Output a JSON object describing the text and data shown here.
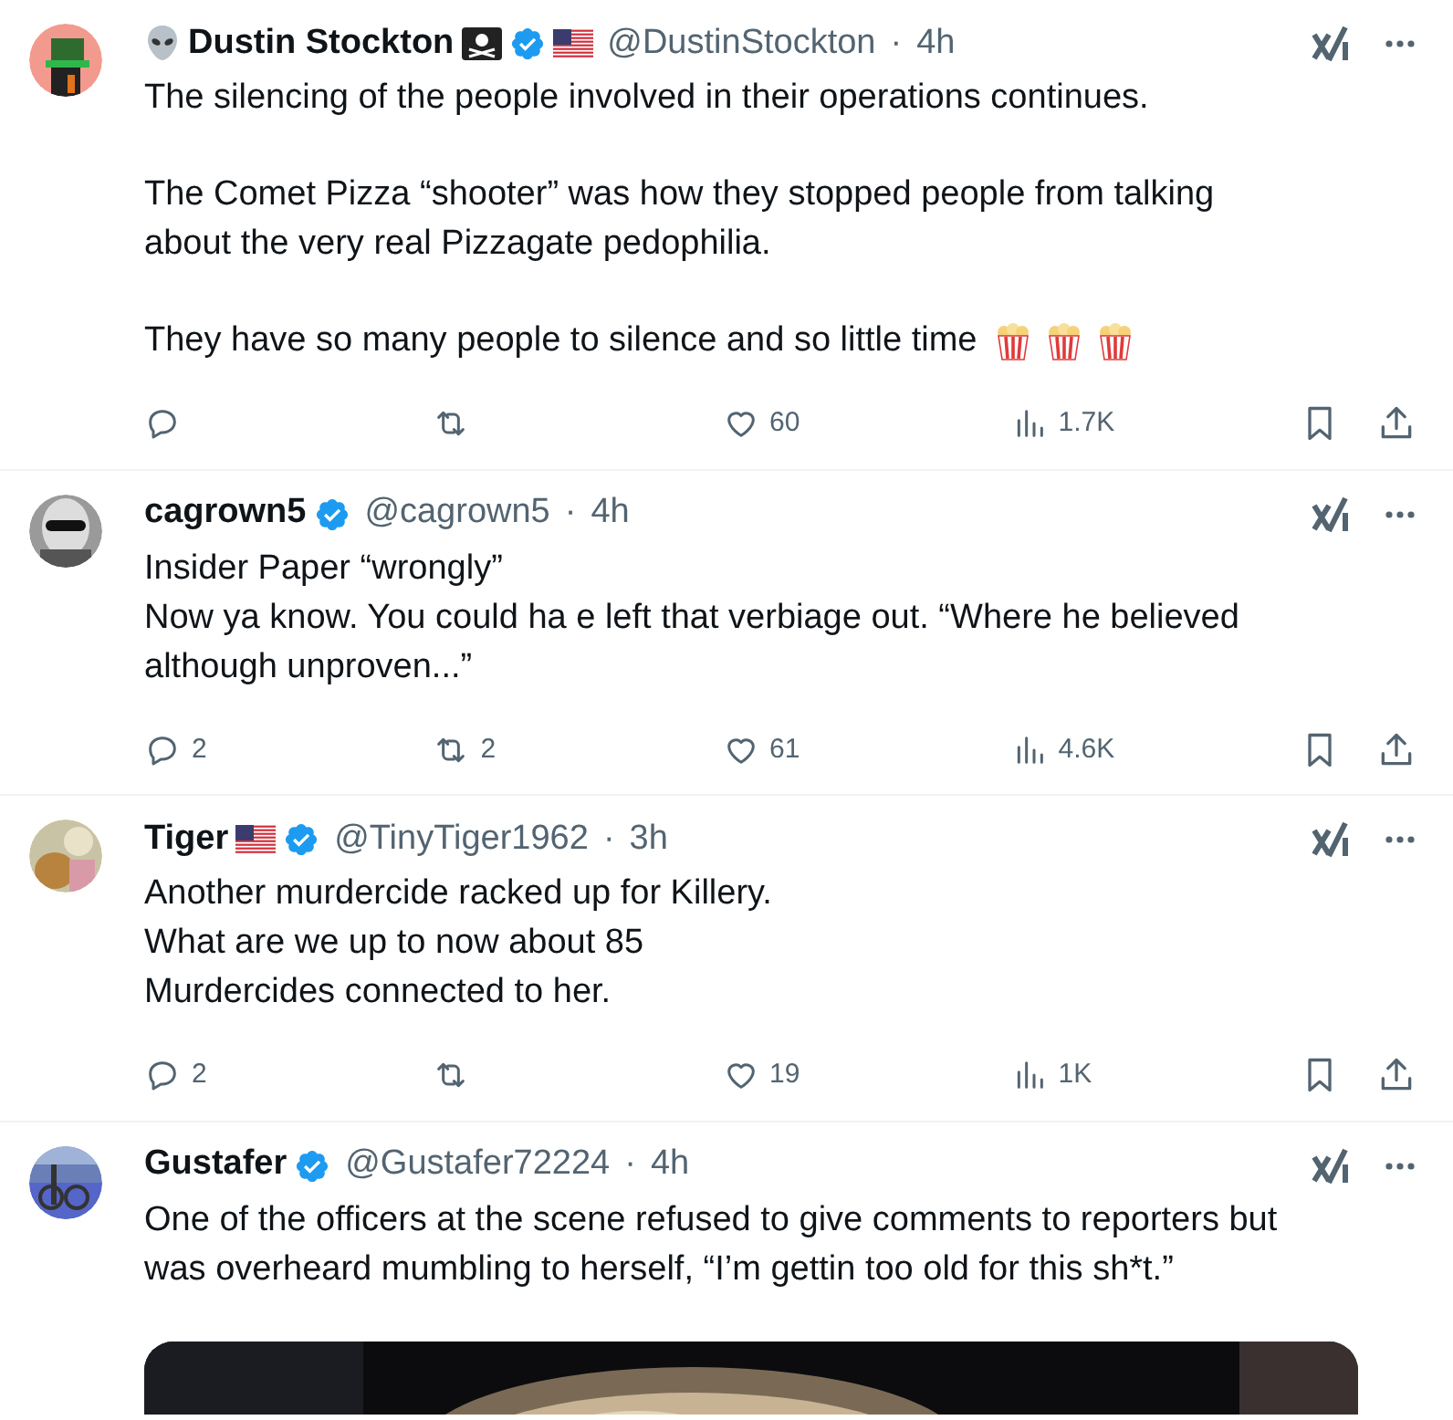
{
  "tweets": [
    {
      "avatar": {
        "kind": "picture"
      },
      "name_prefix": [
        {
          "kind": "alien"
        }
      ],
      "name": "Dustin Stockton",
      "badges": [
        {
          "kind": "pirate-flag"
        },
        {
          "kind": "verified"
        },
        {
          "kind": "us-flag"
        }
      ],
      "handle": "@DustinStockton",
      "separator": "·",
      "time": "4h",
      "paragraphs": [
        [
          "The silencing of the people involved in their operations continues."
        ],
        [
          "The Comet Pizza “shooter” was how they stopped people from talking",
          "about the very real Pizzagate pedophilia."
        ],
        [
          "They have so many people to silence and so little time"
        ]
      ],
      "trailing_emoji": [
        {
          "kind": "popcorn"
        },
        {
          "kind": "popcorn"
        },
        {
          "kind": "popcorn"
        }
      ],
      "stats": {
        "likes": "60",
        "views": "1.7K"
      }
    },
    {
      "avatar": {
        "kind": "picture"
      },
      "name": "cagrown5",
      "badges": [
        {
          "kind": "verified"
        }
      ],
      "handle": "@cagrown5",
      "separator": "·",
      "time": "4h",
      "paragraphs": [
        [
          "Insider Paper “wrongly”",
          "Now ya know. You could ha e left that verbiage out. “Where he believed",
          "although unproven...”"
        ]
      ],
      "stats": {
        "replies": "2",
        "reposts": "2",
        "likes": "61",
        "views": "4.6K"
      }
    },
    {
      "avatar": {
        "kind": "picture"
      },
      "name": "Tiger",
      "badges": [
        {
          "kind": "us-flag"
        },
        {
          "kind": "verified"
        }
      ],
      "handle": "@TinyTiger1962",
      "separator": "·",
      "time": "3h",
      "paragraphs": [
        [
          "Another murdercide racked up for Killery.",
          "What are we up to now about 85",
          "Murdercides connected to her."
        ]
      ],
      "stats": {
        "replies": "2",
        "likes": "19",
        "views": "1K"
      }
    },
    {
      "avatar": {
        "kind": "picture"
      },
      "name": "Gustafer",
      "badges": [
        {
          "kind": "verified"
        }
      ],
      "handle": "@Gustafer72224",
      "separator": "·",
      "time": "4h",
      "paragraphs": [
        [
          "One of the officers at the scene refused to give comments to reporters but",
          "was overheard mumbling to herself, “I’m gettin too old for this sh*t.”"
        ]
      ],
      "media": {
        "kind": "picture"
      }
    }
  ]
}
